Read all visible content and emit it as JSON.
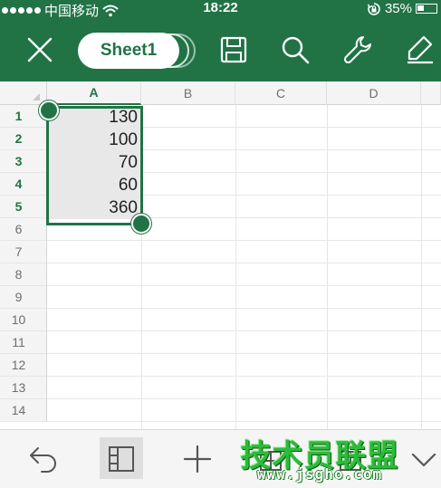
{
  "status_bar": {
    "carrier": "中国移动",
    "time": "18:22",
    "battery_percent": "35%",
    "battery_level": 0.35,
    "icons": [
      "signal-dots",
      "wifi-icon",
      "rotation-lock-icon",
      "battery-icon"
    ]
  },
  "toolbar": {
    "sheet_name": "Sheet1",
    "icons": [
      "close-icon",
      "save-icon",
      "search-icon",
      "wrench-icon",
      "edit-icon"
    ]
  },
  "sheet": {
    "columns": [
      "A",
      "B",
      "C",
      "D"
    ],
    "rows": [
      "1",
      "2",
      "3",
      "4",
      "5",
      "6",
      "7",
      "8",
      "9",
      "10",
      "11",
      "12",
      "13",
      "14"
    ],
    "cells_a": [
      "130",
      "100",
      "70",
      "60",
      "360"
    ],
    "selected_range": "A1:A5"
  },
  "bottom_bar": {
    "icons": [
      "undo-icon",
      "freeze-panes-icon",
      "add-icon",
      "chevron-down-icon"
    ]
  },
  "watermark": {
    "chinese": "技术员联盟",
    "url": "www.jsgho.com"
  },
  "colors": {
    "accent": "#217346",
    "header_bg": "#f4f4f4",
    "selected_fill": "#e8e8e8"
  }
}
